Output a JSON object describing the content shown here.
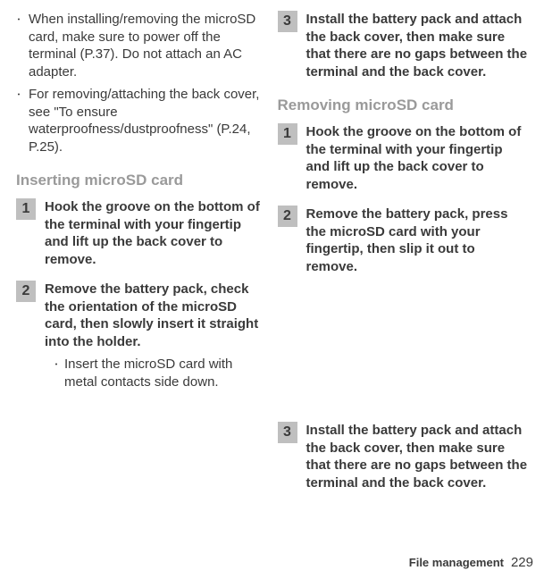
{
  "left": {
    "bullets": [
      "When installing/removing the microSD card, make sure to power off the terminal (P.37). Do not attach an AC adapter.",
      "For removing/attaching the back cover, see \"To ensure waterproofness/dustproofness\" (P.24, P.25)."
    ],
    "heading": "Inserting microSD card",
    "steps": [
      {
        "num": "1",
        "title": "Hook the groove on the bottom of the terminal with your fingertip and lift up the back cover to remove."
      },
      {
        "num": "2",
        "title": "Remove the battery pack, check the orientation of the microSD card, then slowly insert it straight into the holder.",
        "sub": "Insert the microSD card with metal contacts side down."
      }
    ]
  },
  "right": {
    "topStep": {
      "num": "3",
      "title": "Install the battery pack and attach the back cover, then make sure that there are no gaps between the terminal and the back cover."
    },
    "heading": "Removing microSD card",
    "steps": [
      {
        "num": "1",
        "title": "Hook the groove on the bottom of the terminal with your fingertip and lift up the back cover to remove."
      },
      {
        "num": "2",
        "title": "Remove the battery pack, press the microSD card with your fingertip, then slip it out to remove."
      },
      {
        "num": "3",
        "title": "Install the battery pack and attach the back cover, then make sure that there are no gaps between the terminal and the back cover."
      }
    ]
  },
  "footer": {
    "label": "File management",
    "page": "229"
  }
}
